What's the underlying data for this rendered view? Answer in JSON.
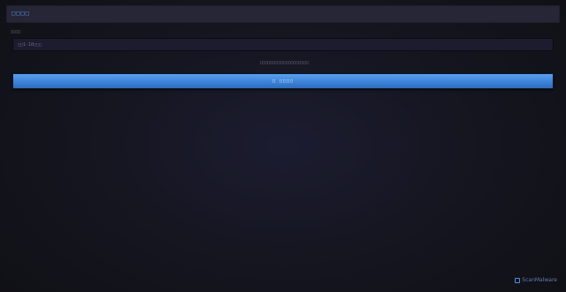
{
  "header": {
    "title": "□□□□"
  },
  "form": {
    "field_label": "□□□□",
    "input_placeholder": "□□1-10□□□",
    "hint": "□□□□□□□□□□□□□□□□□□□",
    "submit_label": "□ □□□□"
  },
  "watermark": {
    "text": "ScanMalware"
  },
  "colors": {
    "accent": "#4f8fd8",
    "button_top": "#59a0f2",
    "button_bottom": "#2f6bbd",
    "background": "#15151f"
  }
}
